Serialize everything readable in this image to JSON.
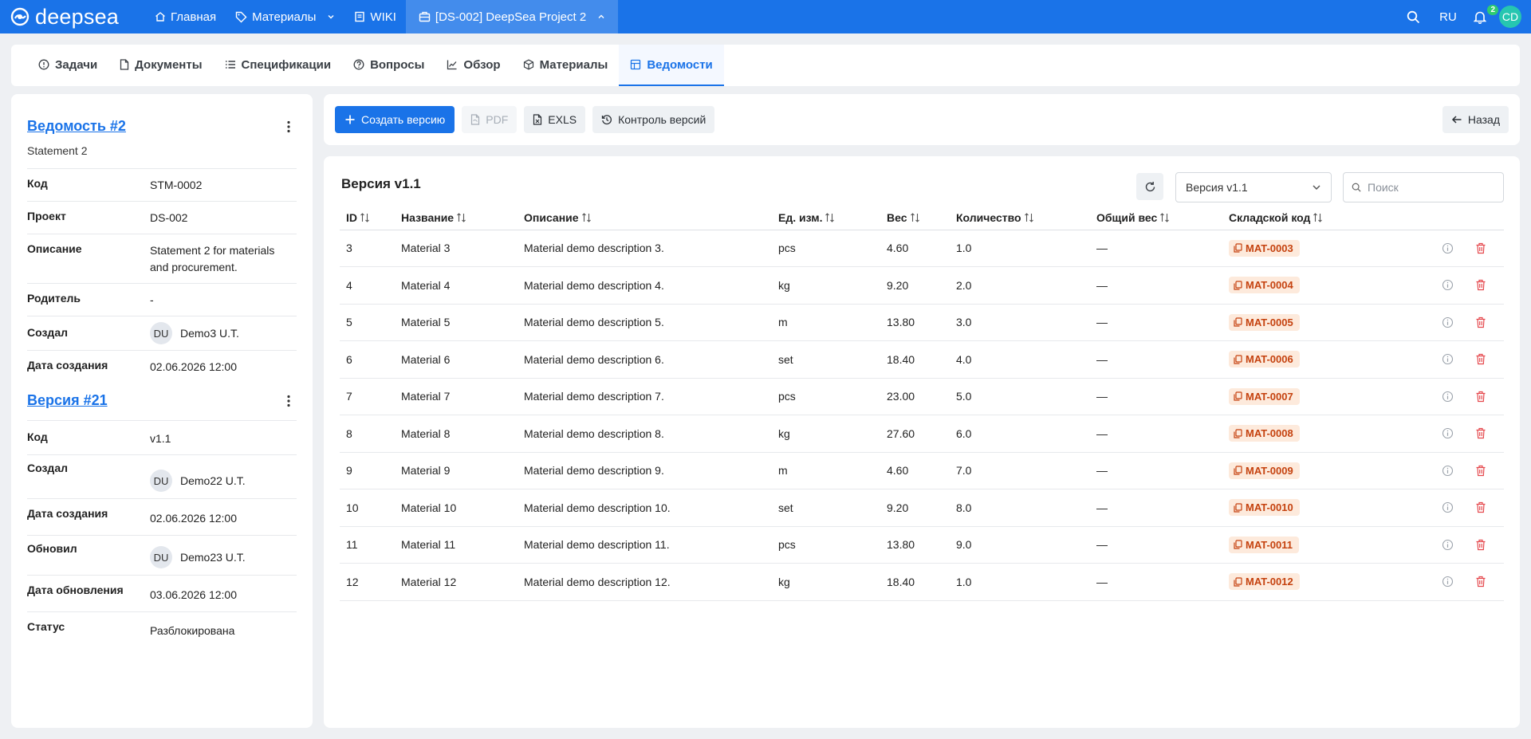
{
  "topbar": {
    "logo_text": "deepsea",
    "nav": [
      {
        "label": "Главная",
        "icon": "home-icon"
      },
      {
        "label": "Материалы",
        "icon": "tag-icon"
      },
      {
        "label": "WIKI",
        "icon": "book-icon"
      },
      {
        "label": "[DS-002] DeepSea Project 2",
        "icon": "briefcase-icon"
      }
    ],
    "language": "RU",
    "notifications_count": "2",
    "user_initials": "CD"
  },
  "tabs": [
    {
      "label": "Задачи",
      "icon": "info-circle-icon"
    },
    {
      "label": "Документы",
      "icon": "file-icon"
    },
    {
      "label": "Спецификации",
      "icon": "list-icon"
    },
    {
      "label": "Вопросы",
      "icon": "question-circle-icon"
    },
    {
      "label": "Обзор",
      "icon": "chart-line-icon"
    },
    {
      "label": "Материалы",
      "icon": "box-icon"
    },
    {
      "label": "Ведомости",
      "icon": "table-icon"
    }
  ],
  "statement": {
    "title": "Ведомость #2",
    "subtitle": "Statement 2",
    "fields": [
      {
        "key": "Код",
        "value": "STM-0002"
      },
      {
        "key": "Проект",
        "value": "DS-002"
      },
      {
        "key": "Описание",
        "value": "Statement 2 for materials and procurement."
      },
      {
        "key": "Родитель",
        "value": "-"
      },
      {
        "key": "Создал",
        "value": "Demo3 U.T.",
        "avatar": "DU"
      },
      {
        "key": "Дата создания",
        "value": "02.06.2026 12:00"
      }
    ]
  },
  "version": {
    "title": "Версия #21",
    "fields": [
      {
        "key": "Код",
        "value": "v1.1"
      },
      {
        "key": "Создал",
        "value": "Demo22 U.T.",
        "avatar": "DU"
      },
      {
        "key": "Дата создания",
        "value": "02.06.2026 12:00"
      },
      {
        "key": "Обновил",
        "value": "Demo23 U.T.",
        "avatar": "DU"
      },
      {
        "key": "Дата обновления",
        "value": "03.06.2026 12:00"
      },
      {
        "key": "Статус",
        "value": "Разблокирована"
      }
    ]
  },
  "toolbar": {
    "create_label": "Создать версию",
    "pdf_label": "PDF",
    "exls_label": "EXLS",
    "versions_label": "Контроль версий",
    "back_label": "Назад"
  },
  "main": {
    "title": "Версия v1.1",
    "version_select": "Версия v1.1",
    "search_placeholder": "Поиск",
    "columns": [
      "ID",
      "Название",
      "Описание",
      "Ед. изм.",
      "Вес",
      "Количество",
      "Общий вес",
      "Складской код"
    ],
    "rows": [
      {
        "id": "3",
        "name": "Material 3",
        "desc": "Material demo description 3.",
        "unit": "pcs",
        "weight": "4.60",
        "qty": "1.0",
        "total": "—",
        "code": "MAT-0003"
      },
      {
        "id": "4",
        "name": "Material 4",
        "desc": "Material demo description 4.",
        "unit": "kg",
        "weight": "9.20",
        "qty": "2.0",
        "total": "—",
        "code": "MAT-0004"
      },
      {
        "id": "5",
        "name": "Material 5",
        "desc": "Material demo description 5.",
        "unit": "m",
        "weight": "13.80",
        "qty": "3.0",
        "total": "—",
        "code": "MAT-0005"
      },
      {
        "id": "6",
        "name": "Material 6",
        "desc": "Material demo description 6.",
        "unit": "set",
        "weight": "18.40",
        "qty": "4.0",
        "total": "—",
        "code": "MAT-0006"
      },
      {
        "id": "7",
        "name": "Material 7",
        "desc": "Material demo description 7.",
        "unit": "pcs",
        "weight": "23.00",
        "qty": "5.0",
        "total": "—",
        "code": "MAT-0007"
      },
      {
        "id": "8",
        "name": "Material 8",
        "desc": "Material demo description 8.",
        "unit": "kg",
        "weight": "27.60",
        "qty": "6.0",
        "total": "—",
        "code": "MAT-0008"
      },
      {
        "id": "9",
        "name": "Material 9",
        "desc": "Material demo description 9.",
        "unit": "m",
        "weight": "4.60",
        "qty": "7.0",
        "total": "—",
        "code": "MAT-0009"
      },
      {
        "id": "10",
        "name": "Material 10",
        "desc": "Material demo description 10.",
        "unit": "set",
        "weight": "9.20",
        "qty": "8.0",
        "total": "—",
        "code": "MAT-0010"
      },
      {
        "id": "11",
        "name": "Material 11",
        "desc": "Material demo description 11.",
        "unit": "pcs",
        "weight": "13.80",
        "qty": "9.0",
        "total": "—",
        "code": "MAT-0011"
      },
      {
        "id": "12",
        "name": "Material 12",
        "desc": "Material demo description 12.",
        "unit": "kg",
        "weight": "18.40",
        "qty": "1.0",
        "total": "—",
        "code": "MAT-0012"
      }
    ]
  },
  "colors": {
    "primary": "#1a73e8",
    "stock_bg": "#fdeadc",
    "stock_text": "#c5420f",
    "danger": "#e5484d"
  }
}
